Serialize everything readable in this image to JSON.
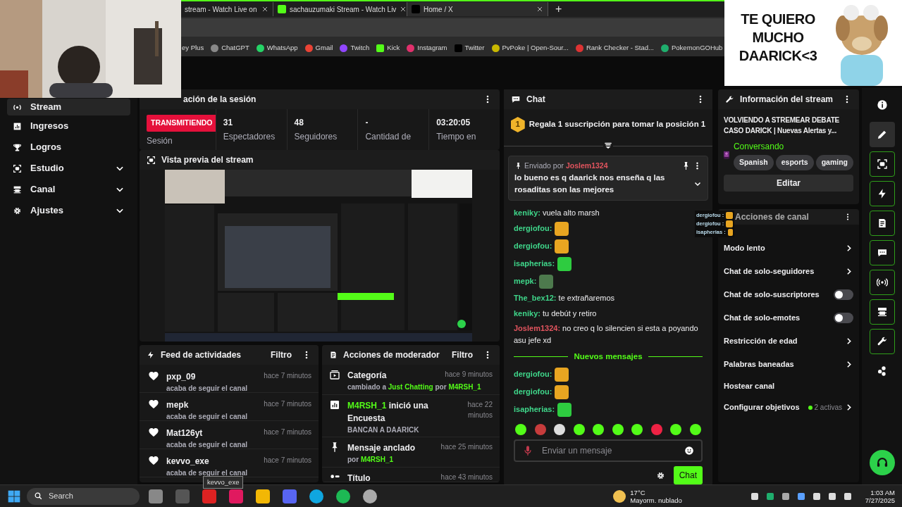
{
  "browser": {
    "tabs": [
      {
        "title": "stream - Watch Live on",
        "selected": false
      },
      {
        "title": "sachauzumaki Stream - Watch Liv",
        "selected": false
      },
      {
        "title": "Home / X",
        "selected": true
      }
    ],
    "new_tab": "+",
    "bookmarks": [
      "ey Plus",
      "ChatGPT",
      "WhatsApp",
      "Gmail",
      "Twitch",
      "Kick",
      "Instagram",
      "Twitter",
      "PvPoke | Open-Sour...",
      "Rank Checker - Stad...",
      "PokemonGOHub"
    ]
  },
  "sidebar": {
    "items": [
      {
        "label": "Stream",
        "selected": true,
        "expandable": false
      },
      {
        "label": "Ingresos",
        "selected": false,
        "expandable": false
      },
      {
        "label": "Logros",
        "selected": false,
        "expandable": false
      },
      {
        "label": "Estudio",
        "selected": false,
        "expandable": true
      },
      {
        "label": "Canal",
        "selected": false,
        "expandable": true
      },
      {
        "label": "Ajustes",
        "selected": false,
        "expandable": true
      }
    ]
  },
  "session": {
    "title": "ación de la sesión",
    "status": "TRANSMITIENDO",
    "stats": [
      {
        "label": "Sesión"
      },
      {
        "value": "31",
        "label": "Espectadores"
      },
      {
        "value": "48",
        "label": "Seguidores"
      },
      {
        "value": "-",
        "label": "Cantidad de"
      },
      {
        "value": "03:20:05",
        "label": "Tiempo en"
      }
    ]
  },
  "preview": {
    "title": "Vista previa del stream"
  },
  "activity_feed": {
    "title": "Feed de actividades",
    "filter": "Filtro",
    "items": [
      {
        "user": "pxp_09",
        "action": "acaba de seguir el canal",
        "time": "hace 7 minutos"
      },
      {
        "user": "mepk",
        "action": "acaba de seguir el canal",
        "time": "hace 7 minutos"
      },
      {
        "user": "Mat126yt",
        "action": "acaba de seguir el canal",
        "time": "hace 7 minutos"
      },
      {
        "user": "kevvo_exe",
        "action": "acaba de seguir el canal",
        "time": "hace 7 minutos"
      }
    ]
  },
  "mod_actions": {
    "title": "Acciones de moderador",
    "filter": "Filtro",
    "items": [
      {
        "kind": "category",
        "title": "Categoría",
        "detail": "cambiado a **Just Chatting** por **M4RSH_1**",
        "time": "hace 9 minutos"
      },
      {
        "kind": "poll",
        "title": "**M4RSH_1** inició una Encuesta",
        "detail": "BANCAN A DAARICK",
        "time": "hace 22 minutos"
      },
      {
        "kind": "pin",
        "title": "Mensaje anclado",
        "detail": "por **M4RSH_1**",
        "time": "hace 25 minutos"
      },
      {
        "kind": "title",
        "title": "Título",
        "time": "hace 43 minutos"
      }
    ]
  },
  "chat": {
    "title": "Chat",
    "promo_rank": "1",
    "promo": "Regala 1 suscripción para tomar la posición 1",
    "pinned": {
      "label": "Enviado por",
      "user": "Joslem1324",
      "text": "lo bueno es q daarick nos enseña q las rosaditas son las mejores"
    },
    "messages": [
      {
        "user": "keniky:",
        "color": "#3fd68a",
        "text": "vuela alto marsh"
      },
      {
        "user": "dergiofou:",
        "color": "#3fd68a",
        "kind": "emote"
      },
      {
        "user": "dergiofou:",
        "color": "#3fd68a",
        "kind": "emote"
      },
      {
        "user": "isapherias:",
        "color": "#3fd68a",
        "kind": "emote"
      },
      {
        "user": "mepk:",
        "color": "#3fd68a",
        "kind": "emote"
      },
      {
        "user": "The_bex12:",
        "color": "#3fd68a",
        "text": "te extrañaremos"
      },
      {
        "user": "keniky:",
        "color": "#3fd68a",
        "text": "tu debút y retiro"
      },
      {
        "user": "Joslem1324:",
        "color": "#e2545e",
        "text": "no creo q lo silencien si esta a poyando asu jefe xd"
      },
      {
        "kind": "divider",
        "text": "Nuevos mensajes"
      },
      {
        "user": "dergiofou:",
        "color": "#3fd68a",
        "kind": "emote"
      },
      {
        "user": "dergiofou:",
        "color": "#3fd68a",
        "kind": "emote"
      },
      {
        "user": "isapherias:",
        "color": "#3fd68a",
        "kind": "emote"
      }
    ],
    "input_placeholder": "Enviar un mensaje",
    "send": "Chat"
  },
  "stream_info": {
    "title": "Información del stream",
    "stream_title": "VOLVIENDO A STREMEAR DEBATE CASO DARICK | Nuevas Alertas y...",
    "category": "Conversando",
    "tags": [
      "Spanish",
      "esports",
      "gaming"
    ],
    "edit": "Editar"
  },
  "channel_actions": {
    "title": "Acciones de canal",
    "items": [
      {
        "label": "Modo lento",
        "kind": "chevron"
      },
      {
        "label": "Chat de solo-seguidores",
        "kind": "chevron"
      },
      {
        "label": "Chat de solo-suscriptores",
        "kind": "toggle",
        "on": false
      },
      {
        "label": "Chat de solo-emotes",
        "kind": "toggle",
        "on": false
      },
      {
        "label": "Restricción de edad",
        "kind": "chevron"
      },
      {
        "label": "Palabras baneadas",
        "kind": "chevron"
      },
      {
        "label": "Hostear canal",
        "kind": "plain"
      },
      {
        "label": "Configurar objetivos",
        "kind": "chevron",
        "badge": "2 activas"
      }
    ]
  },
  "overlay": {
    "text": "TE QUIERO MUCHO DAARICK<3",
    "chat": [
      {
        "user": "dergiofou :"
      },
      {
        "user": "dergiofou :"
      },
      {
        "user": "isapherias :"
      }
    ]
  },
  "tooltip": "kevvo_exe",
  "taskbar": {
    "search": "Search",
    "weather_temp": "17°C",
    "weather_text": "Mayorm. nublado",
    "time": "1:03 AM",
    "date": "7/27/2025"
  }
}
